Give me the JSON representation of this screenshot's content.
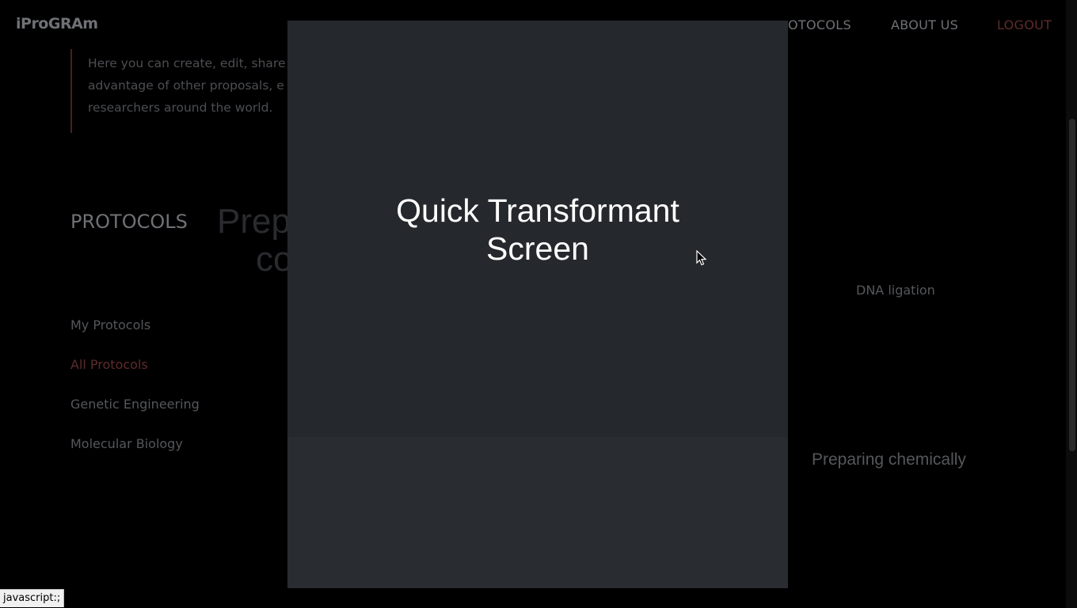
{
  "navbar": {
    "brand": "iProGRAm",
    "links": [
      {
        "label": "OTOCOLS"
      },
      {
        "label": "ABOUT US"
      },
      {
        "label": "LOGOUT"
      }
    ],
    "logout_color": "#5e2b2c"
  },
  "intro": {
    "lines": [
      "Here you can create, edit, share",
      "advantage of other proposals, e",
      "researchers around the world."
    ]
  },
  "sidebar": {
    "title": "PROTOCOLS",
    "items": [
      {
        "label": "My Protocols"
      },
      {
        "label": "All Protocols"
      },
      {
        "label": "Genetic Engineering"
      },
      {
        "label": "Molecular Biology"
      }
    ]
  },
  "cards": {
    "big_title_line1": "Prep",
    "big_title_line2": "co",
    "dna_ligation": "DNA ligation",
    "preparing_chemically": "Preparing chemically"
  },
  "modal": {
    "title_line1": "Quick Transformant",
    "title_line2": "Screen"
  },
  "status_bar": {
    "text": "javascript:;"
  }
}
